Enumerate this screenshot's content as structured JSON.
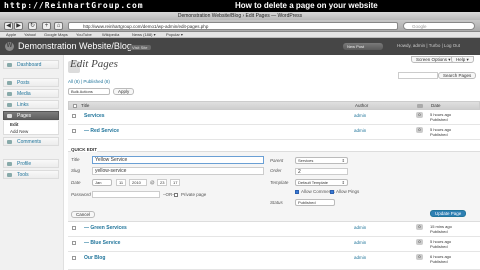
{
  "banner": {
    "left": "http://ReinhartGroup.com",
    "right": "How to delete a page on your website"
  },
  "browser": {
    "window_title": "Demonstration Website/Blog › Edit Pages — WordPress",
    "url": "http://www.reinhartgroup.com/demo1/wp-admin/edit-pages.php",
    "search_placeholder": "Google",
    "bookmarks": [
      "Apple",
      "Yahoo!",
      "Google Maps",
      "YouTube",
      "Wikipedia",
      "News (188) ▾",
      "Popular ▾"
    ]
  },
  "wp_header": {
    "site_title": "Demonstration Website/Blog",
    "visit_site": "Visit Site",
    "favorites": "New Post",
    "howdy": "Howdy, admin | Turbo | Log Out"
  },
  "sidebar": {
    "items": [
      {
        "label": "Dashboard"
      },
      {
        "label": "Posts"
      },
      {
        "label": "Media"
      },
      {
        "label": "Links"
      },
      {
        "label": "Pages"
      },
      {
        "label": "Comments"
      },
      {
        "label": "Profile"
      },
      {
        "label": "Tools"
      }
    ],
    "pages_sub": [
      "Edit",
      "Add New"
    ]
  },
  "main": {
    "title": "Edit Pages",
    "screen_options": "Screen Options ▾",
    "help": "Help ▾",
    "filter": "All (8) | Published (8)",
    "search_button": "Search Pages",
    "bulk_action": "Bulk Actions",
    "apply": "Apply",
    "columns": {
      "title": "Title",
      "author": "Author",
      "date": "Date"
    },
    "rows_top": [
      {
        "title": "Services",
        "author": "admin",
        "comments": "0",
        "date_line1": "5 hours ago",
        "date_line2": "Published"
      },
      {
        "title": "— Red Service",
        "author": "admin",
        "comments": "0",
        "date_line1": "5 hours ago",
        "date_line2": "Published"
      }
    ],
    "quick_edit": {
      "heading": "QUICK EDIT",
      "title_label": "Title",
      "title_value": "Yellow Service",
      "slug_label": "Slug",
      "slug_value": "yellow-service",
      "date_label": "Date",
      "month": "Jan",
      "day": "11",
      "year": "2010",
      "at": "@",
      "hour": "23",
      "minute": "17",
      "password_label": "Password",
      "or_label": "–OR–",
      "private_label": "Private page",
      "parent_label": "Parent",
      "parent_value": "Services",
      "order_label": "Order",
      "order_value": "2",
      "template_label": "Template",
      "template_value": "Default Template",
      "allow_comments": "Allow Comments",
      "allow_pings": "Allow Pings",
      "status_label": "Status",
      "status_value": "Published",
      "cancel": "Cancel",
      "update": "Update Page"
    },
    "rows_bottom": [
      {
        "title": "— Green Services",
        "author": "admin",
        "comments": "0",
        "date_line1": "15 mins ago",
        "date_line2": "Published"
      },
      {
        "title": "— Blue Service",
        "author": "admin",
        "comments": "0",
        "date_line1": "5 hours ago",
        "date_line2": "Published"
      },
      {
        "title": "Our Blog",
        "author": "admin",
        "comments": "0",
        "date_line1": "6 hours ago",
        "date_line2": "Published"
      }
    ]
  }
}
